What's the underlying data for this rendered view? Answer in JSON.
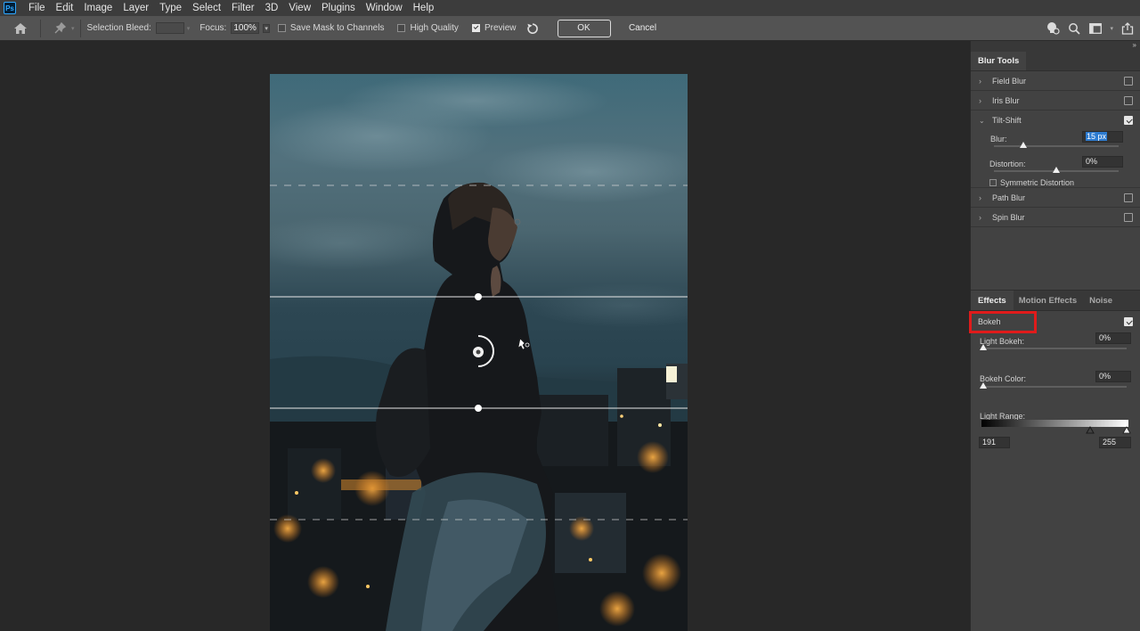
{
  "menu": {
    "logo": "Ps",
    "items": [
      "File",
      "Edit",
      "Image",
      "Layer",
      "Type",
      "Select",
      "Filter",
      "3D",
      "View",
      "Plugins",
      "Window",
      "Help"
    ]
  },
  "options": {
    "selection_bleed_label": "Selection Bleed:",
    "focus_label": "Focus:",
    "focus_value": "100%",
    "save_mask_label": "Save Mask to Channels",
    "high_quality_label": "High Quality",
    "preview_label": "Preview",
    "ok_label": "OK",
    "cancel_label": "Cancel",
    "save_mask_checked": false,
    "high_quality_checked": false,
    "preview_checked": true
  },
  "blur_tools": {
    "tab_label": "Blur Tools",
    "field_blur": {
      "label": "Field Blur",
      "checked": false
    },
    "iris_blur": {
      "label": "Iris Blur",
      "checked": false
    },
    "tilt_shift": {
      "label": "Tilt-Shift",
      "checked": true,
      "blur_label": "Blur:",
      "blur_value": "15 px",
      "distortion_label": "Distortion:",
      "distortion_value": "0%",
      "symmetric_label": "Symmetric Distortion",
      "symmetric_checked": false
    },
    "path_blur": {
      "label": "Path Blur",
      "checked": false
    },
    "spin_blur": {
      "label": "Spin Blur",
      "checked": false
    }
  },
  "effects": {
    "tabs": [
      "Effects",
      "Motion Effects",
      "Noise"
    ],
    "bokeh_label": "Bokeh",
    "bokeh_checked": true,
    "light_bokeh_label": "Light Bokeh:",
    "light_bokeh_value": "0%",
    "bokeh_color_label": "Bokeh Color:",
    "bokeh_color_value": "0%",
    "light_range_label": "Light Range:",
    "light_range_low": "191",
    "light_range_high": "255"
  },
  "colors": {
    "highlight": "#e01b1b",
    "accent_blue": "#31a8ff"
  }
}
